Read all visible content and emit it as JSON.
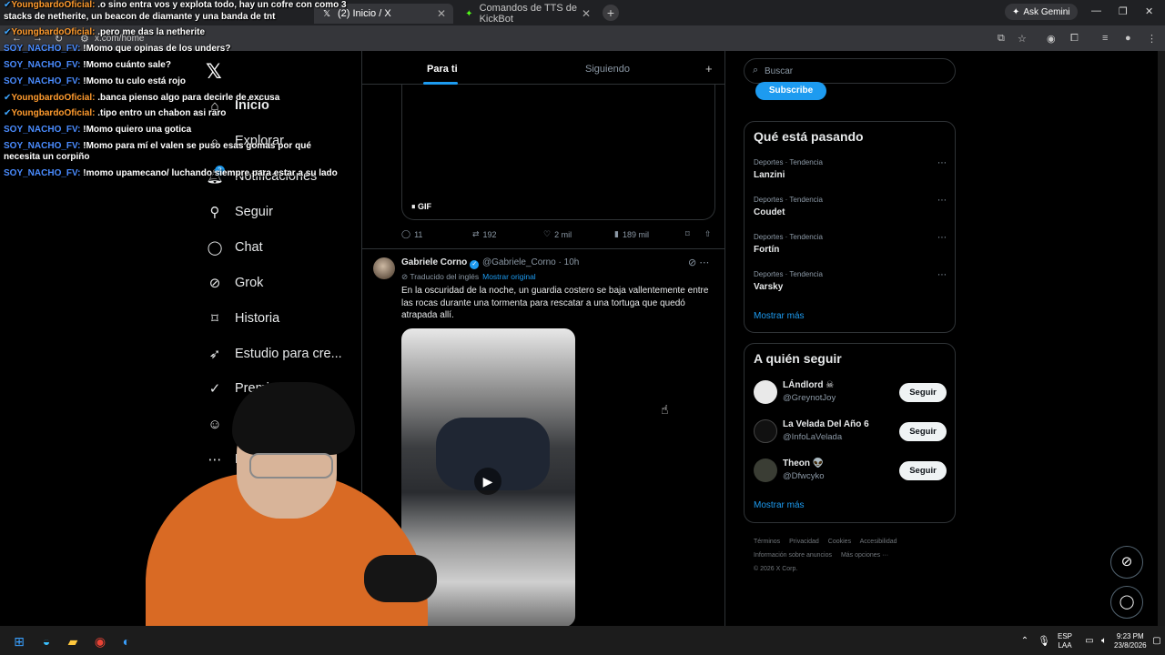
{
  "browser": {
    "tabs": [
      {
        "title": "(2) Inicio / X",
        "icon": "x-logo-icon"
      },
      {
        "title": "Comandos de TTS de KickBot",
        "icon": "kickbot-icon"
      }
    ],
    "ask_gemini": "Ask Gemini",
    "url": "x.com/home"
  },
  "chat": [
    {
      "nick": "YoungbardoOficial:",
      "color": "orange",
      "badge": "✔",
      "msg": ".o sino entra vos y explota todo, hay un cofre con como 3 stacks de netherite, un beacon de diamante y una banda de tnt"
    },
    {
      "nick": "YoungbardoOficial:",
      "color": "orange",
      "badge": "✔",
      "msg": ".pero me das la netherite"
    },
    {
      "nick": "SOY_NACHO_FV:",
      "color": "blue",
      "badge": "",
      "msg": "!Momo que opinas de los unders?"
    },
    {
      "nick": "SOY_NACHO_FV:",
      "color": "blue",
      "badge": "",
      "msg": "!Momo cuánto sale?"
    },
    {
      "nick": "SOY_NACHO_FV:",
      "color": "blue",
      "badge": "",
      "msg": "!Momo tu culo está rojo"
    },
    {
      "nick": "YoungbardoOficial:",
      "color": "orange",
      "badge": "✔",
      "msg": ".banca pienso algo para decirle de excusa"
    },
    {
      "nick": "YoungbardoOficial:",
      "color": "orange",
      "badge": "✔",
      "msg": ".tipo entro un chabon asi raro"
    },
    {
      "nick": "SOY_NACHO_FV:",
      "color": "blue",
      "badge": "",
      "msg": "!Momo quiero una gotica"
    },
    {
      "nick": "SOY_NACHO_FV:",
      "color": "blue",
      "badge": "",
      "msg": "!Momo para mí el valen se puso esas gomas por qué necesita un corpiño"
    },
    {
      "nick": "SOY_NACHO_FV:",
      "color": "blue",
      "badge": "",
      "msg": "!momo upamecano/ luchando siempre para estar a su lado"
    }
  ],
  "nav": {
    "items": [
      {
        "label": "Inicio",
        "icon": "home-icon"
      },
      {
        "label": "Explorar",
        "icon": "search-icon"
      },
      {
        "label": "Notificaciones",
        "icon": "bell-icon"
      },
      {
        "label": "Seguir",
        "icon": "person-add-icon"
      },
      {
        "label": "Chat",
        "icon": "chat-icon"
      },
      {
        "label": "Grok",
        "icon": "grok-icon"
      },
      {
        "label": "Historia",
        "icon": "bookmark-icon"
      },
      {
        "label": "Estudio para cre...",
        "icon": "rocket-icon"
      },
      {
        "label": "Premi",
        "icon": "verified-icon"
      },
      {
        "label": "Pe",
        "icon": "profile-icon"
      },
      {
        "label": "Ma",
        "icon": "more-icon"
      }
    ],
    "badge": "2"
  },
  "home_tabs": {
    "for_you": "Para ti",
    "following": "Siguiendo"
  },
  "prev_tweet": {
    "gif_label": "GIF",
    "replies": "11",
    "reposts": "192",
    "likes": "2 mil",
    "views": "189 mil"
  },
  "tweet": {
    "name": "Gabriele Corno",
    "handle": "@Gabriele_Corno · 10h",
    "translated": "Traducido del inglés",
    "show_original": "Mostrar original",
    "text": "En la oscuridad de la noche, un guardia costero se baja vallentemente entre las rocas durante una tormenta para rescatar a una tortuga que quedó atrapada allí."
  },
  "right": {
    "search_placeholder": "Buscar",
    "subscribe": "Subscribe",
    "trending_title": "Qué está pasando",
    "trends": [
      {
        "category": "Deportes · Tendencia",
        "name": "Lanzini"
      },
      {
        "category": "Deportes · Tendencia",
        "name": "Coudet"
      },
      {
        "category": "Deportes · Tendencia",
        "name": "Fortín"
      },
      {
        "category": "Deportes · Tendencia",
        "name": "Varsky"
      }
    ],
    "show_more": "Mostrar más",
    "who_title": "A quién seguir",
    "who": [
      {
        "name": "LÁndlord ☠",
        "handle": "@GreynotJoy",
        "follow": "Seguir"
      },
      {
        "name": "La Velada Del Año 6",
        "handle": "@InfoLaVelada",
        "follow": "Seguir"
      },
      {
        "name": "Theon 👽",
        "handle": "@Dfwcyko",
        "follow": "Seguir"
      }
    ],
    "footer": [
      "Términos",
      "Privacidad",
      "Cookies",
      "Accesibilidad",
      "Información sobre anuncios",
      "Más opciones ···",
      "© 2026 X Corp."
    ]
  },
  "taskbar": {
    "lang": "ESP",
    "lang2": "LAA",
    "time": "9:23 PM",
    "date": "23/8/2026"
  }
}
